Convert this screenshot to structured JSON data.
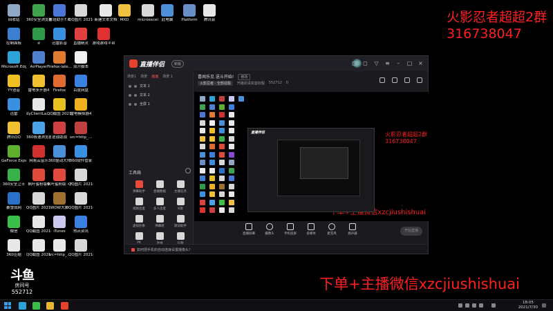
{
  "overlay": {
    "group_name": "火影忍者超超2群",
    "group_number": "316738047",
    "promo": "下单+主播微信xzcjiushishuai"
  },
  "room": {
    "logo": "斗鱼",
    "label": "房间号",
    "number": "552712"
  },
  "desktop_icons": [
    {
      "label": "回收站",
      "color": "#8fa8c8"
    },
    {
      "label": "360安全浏览器",
      "color": "#3fa34d"
    },
    {
      "label": "鲁班助手7.0",
      "color": "#4b78d8"
    },
    {
      "label": "QQ图片 20210719...",
      "color": "#d8d8d8"
    },
    {
      "label": "新建文本文档",
      "color": "#e8e8e8"
    },
    {
      "label": "MXD",
      "color": "#f0c040"
    },
    {
      "label": "microexcel",
      "color": "#d8d8d8"
    },
    {
      "label": "此电脑",
      "color": "#4a8fd8"
    },
    {
      "label": "Platform",
      "color": "#6a8fc8"
    },
    {
      "label": "腾讯会",
      "color": "#e8e8e8"
    },
    {
      "label": "控制面板",
      "color": "#3c7fd0"
    },
    {
      "label": "d",
      "color": "#2f9a4a"
    },
    {
      "label": "迅雷影音",
      "color": "#3a90e0"
    },
    {
      "label": "直播精灵",
      "color": "#e04040"
    },
    {
      "label": "游戏游戏平台",
      "color": "#e03030"
    },
    {
      "label": "Microsoft Edge",
      "color": "#2ba3d8"
    },
    {
      "label": "AirPlayer",
      "color": "#5080d0"
    },
    {
      "label": "Firefox-late...",
      "color": "#e07b2f"
    },
    {
      "label": "双开脚本",
      "color": "#f0f0f0"
    },
    {
      "label": "YY语音",
      "color": "#f0c020"
    },
    {
      "label": "雷电多开器4",
      "color": "#f0c030"
    },
    {
      "label": "Firefox",
      "color": "#e06b2f"
    },
    {
      "label": "百度网盘",
      "color": "#3a80e0"
    },
    {
      "label": "迅雷",
      "color": "#3a8fe0"
    },
    {
      "label": "dyClientLa... - 快捷方式",
      "color": "#e8e8e8"
    },
    {
      "label": "QQ截图 20210605...",
      "color": "#e8c020"
    },
    {
      "label": "雷电模拟器4",
      "color": "#f0b020"
    },
    {
      "label": "腾讯QQ",
      "color": "#f0c030"
    },
    {
      "label": "360极速浏览器",
      "color": "#4aa3e8"
    },
    {
      "label": "逆战助战",
      "color": "#d04040"
    },
    {
      "label": "src=http_...",
      "color": "#c04040"
    },
    {
      "label": "GeForce Experience",
      "color": "#60b030"
    },
    {
      "label": "网易云音乐",
      "color": "#d03030"
    },
    {
      "label": "360驱动大师",
      "color": "#4a90d8"
    },
    {
      "label": "360软件管家",
      "color": "#3a90e0"
    },
    {
      "label": "360安全卫士",
      "color": "#3ab04a"
    },
    {
      "label": "枫叶蜜粉版4",
      "color": "#e04a3a"
    },
    {
      "label": "枫叶蜜粉版 - 户版下载器",
      "color": "#e04a3a"
    },
    {
      "label": "QQ图片 20210719...",
      "color": "#d8d8d8"
    },
    {
      "label": "暴雪战网",
      "color": "#2a70c8"
    },
    {
      "label": "QQ图片 2021070...",
      "color": "#d8d8d8"
    },
    {
      "label": "WOW大脚",
      "color": "#a07030"
    },
    {
      "label": "QQ图片 20210719...",
      "color": "#d8d8d8"
    },
    {
      "label": "微信",
      "color": "#3ac04a"
    },
    {
      "label": "QQ截图 20210605...",
      "color": "#e8e8e8"
    },
    {
      "label": "iTunes",
      "color": "#c8c8f0"
    },
    {
      "label": "热点资讯",
      "color": "#3a80e0"
    },
    {
      "label": "360压缩",
      "color": "#e8e8e8"
    },
    {
      "label": "QQ截图 20210605...",
      "color": "#e8e8e8"
    },
    {
      "label": "src=http_...",
      "color": "#e8e8e8"
    },
    {
      "label": "QQ图片 20210722...",
      "color": "#d8d8d8"
    },
    {
      "label": "u=281770...",
      "color": "#e8e8e8"
    },
    {
      "label": "电乐思",
      "color": "#8a4ad8"
    }
  ],
  "window": {
    "title": "直播伴侣",
    "badge": "新版",
    "tabs": [
      "场景1",
      "场景",
      "画面",
      "场景 1"
    ],
    "active_tab_index": 2,
    "scenes": [
      "文本 1",
      "文本 2",
      "全屏 1"
    ],
    "tools_title": "工具箱",
    "tools": [
      "弹幕助手",
      "直播数据",
      "主播任务",
      "视频连麦",
      "多人连麦",
      "K歌",
      "虚拟形象",
      "弹幕姬",
      "歌词助手",
      "PK",
      "连线",
      "礼物"
    ],
    "stream_title": "喜闻乐见 送斗开始!",
    "stream_tag": "修改",
    "stream_category": "火影忍者 · 全部话题",
    "stream_notice": "开播前请完善标题",
    "stream_room": "552712",
    "stream_viewers": "0",
    "bottom_tools": [
      "直播屏幕",
      "摄像头",
      "手机投屏",
      "多媒体",
      "麦克风",
      "扬声器"
    ],
    "start_label": "开始直播",
    "status_text": "如何把手机的自动连接设置摄像头？"
  },
  "preview": {
    "mini_group_name": "火影忍者超超2群",
    "mini_group_number": "316738047",
    "mini_promo": "下单+主播微信xzcjiushishuai",
    "mini_title": "直播伴侣"
  },
  "taskbar": {
    "time": "18:05",
    "date": "2021/7/30"
  }
}
